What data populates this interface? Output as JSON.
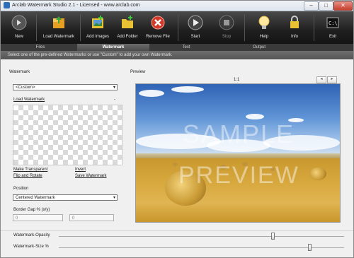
{
  "window": {
    "title": "Arclab Watermark Studio 2.1 - Licensed - www.arclab.com",
    "min_glyph": "–",
    "max_glyph": "□",
    "close_glyph": "✕"
  },
  "toolbar": {
    "new": {
      "label": "New",
      "icon": "new-icon"
    },
    "load_watermark": {
      "label": "Load Watermark",
      "icon": "load-watermark-icon"
    },
    "add_images": {
      "label": "Add Images",
      "icon": "add-images-icon"
    },
    "add_folder": {
      "label": "Add Folder",
      "icon": "add-folder-icon"
    },
    "remove_file": {
      "label": "Remove File",
      "icon": "remove-file-icon"
    },
    "start": {
      "label": "Start",
      "icon": "start-icon"
    },
    "stop": {
      "label": "Stop",
      "icon": "stop-icon"
    },
    "help": {
      "label": "Help",
      "icon": "help-icon"
    },
    "info": {
      "label": "Info",
      "icon": "info-icon"
    },
    "exit": {
      "label": "Exit",
      "icon": "exit-icon"
    }
  },
  "tabs": [
    {
      "label": "Files"
    },
    {
      "label": "Watermark"
    },
    {
      "label": "Text"
    },
    {
      "label": "Output"
    }
  ],
  "active_tab": "Watermark",
  "info_text": "Select one of the pre-defined Watermarks or use \"Custom\" to add your own Watermark.",
  "watermark_panel": {
    "heading": "Watermark",
    "preset_value": "<Custom>",
    "load_link": "Load Watermark",
    "load_dash": "-",
    "make_transparent": "Make Transparent",
    "invert": "Invert",
    "flip_rotate": "Flip and Rotate",
    "save_watermark": "Save Watermark",
    "position_label": "Position",
    "position_value": "Centered Watermark",
    "border_gap_label": "Border Gap % (x/y)",
    "gap_x": "0",
    "gap_y": "0"
  },
  "preview": {
    "heading": "Preview",
    "zoom": "1:1",
    "prev_glyph": "◂",
    "next_glyph": "▸",
    "watermark_line1": "SAMPLE",
    "watermark_line2": "PREVIEW"
  },
  "sliders": {
    "opacity_label": "Watermark-Opacity",
    "opacity_level": 0.75,
    "size_label": "Watermark-Size %",
    "size_level": 0.88
  },
  "colors": {
    "toolbar_bg": "#1f1f1f",
    "tab_active": "#4c4c4c",
    "close_red": "#c4402f"
  }
}
